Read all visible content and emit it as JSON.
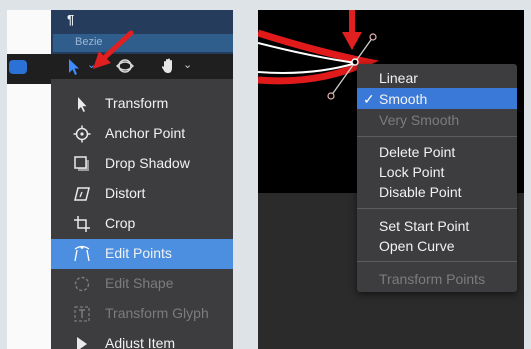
{
  "toolbar": {
    "track_label": "Bezie",
    "marker_glyph": "¶",
    "chevron": "⌄"
  },
  "left_menu": {
    "items": [
      {
        "label": "Transform",
        "icon": "pointer-arrow-icon",
        "state": "normal"
      },
      {
        "label": "Anchor Point",
        "icon": "anchor-point-icon",
        "state": "normal"
      },
      {
        "label": "Drop Shadow",
        "icon": "drop-shadow-icon",
        "state": "normal"
      },
      {
        "label": "Distort",
        "icon": "distort-icon",
        "state": "normal"
      },
      {
        "label": "Crop",
        "icon": "crop-icon",
        "state": "normal"
      },
      {
        "label": "Edit Points",
        "icon": "edit-points-icon",
        "state": "selected"
      },
      {
        "label": "Edit Shape",
        "icon": "edit-shape-icon",
        "state": "disabled"
      },
      {
        "label": "Transform Glyph",
        "icon": "transform-glyph-icon",
        "state": "disabled"
      },
      {
        "label": "Adjust Item",
        "icon": "adjust-item-icon",
        "state": "normal"
      }
    ]
  },
  "right_menu": {
    "check_glyph": "✓",
    "items": [
      {
        "label": "Linear",
        "state": "normal"
      },
      {
        "label": "Smooth",
        "state": "selected",
        "checked": true
      },
      {
        "label": "Very Smooth",
        "state": "disabled"
      },
      {
        "label": "Delete Point",
        "state": "normal"
      },
      {
        "label": "Lock Point",
        "state": "normal"
      },
      {
        "label": "Disable Point",
        "state": "normal"
      },
      {
        "label": "Set Start Point",
        "state": "normal"
      },
      {
        "label": "Open Curve",
        "state": "normal"
      },
      {
        "label": "Transform Points",
        "state": "disabled"
      }
    ]
  },
  "colors": {
    "accent_selected": "#4c8fe0",
    "menu_background": "#3d3d3f",
    "annotation_arrow": "#e02020",
    "curve_red": "#e01a1a"
  }
}
